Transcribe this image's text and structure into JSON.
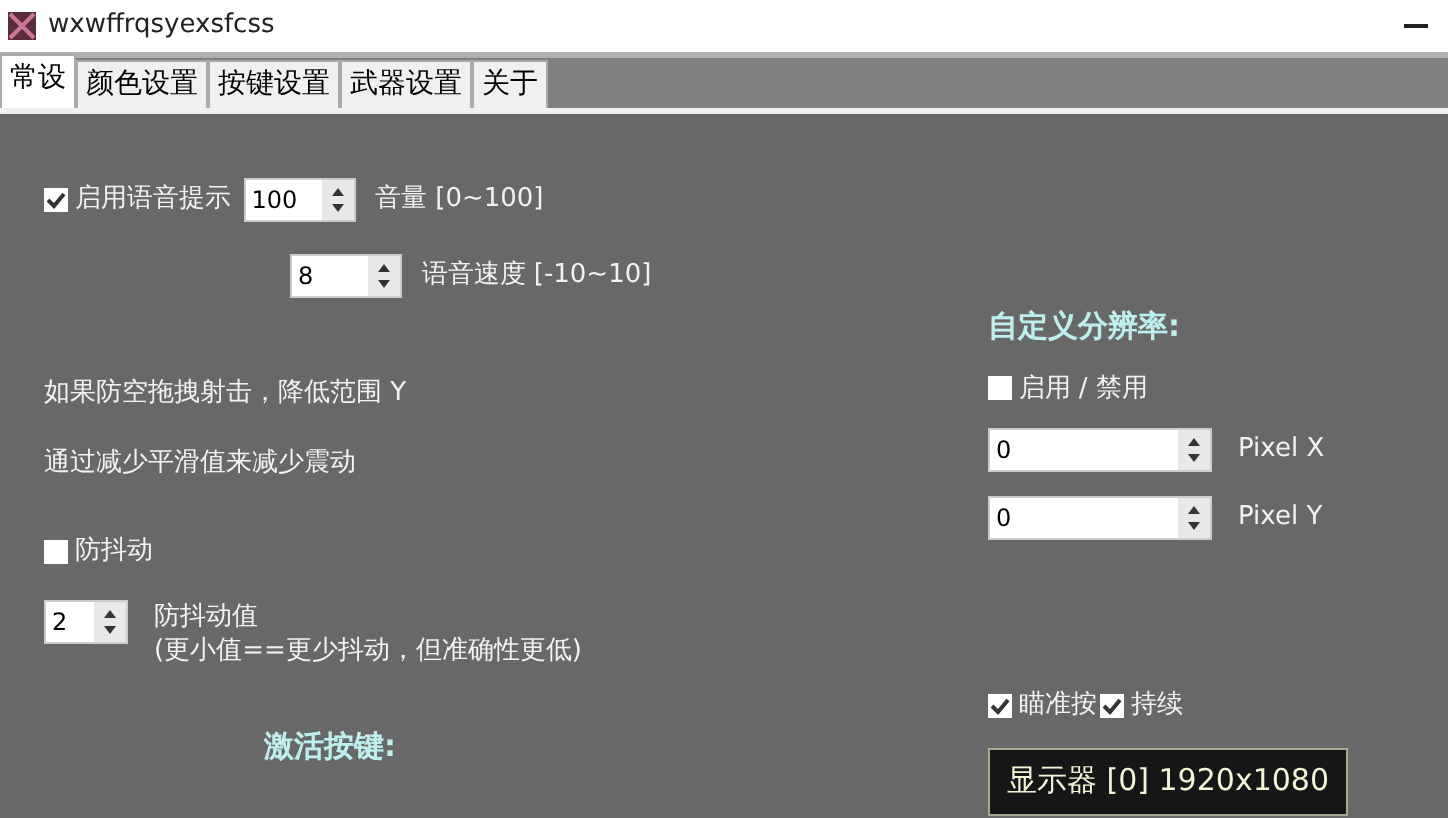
{
  "window": {
    "title": "wxwffrqsyexsfcss"
  },
  "tabs": [
    {
      "label": "常设",
      "selected": true
    },
    {
      "label": "颜色设置",
      "selected": false
    },
    {
      "label": "按键设置",
      "selected": false
    },
    {
      "label": "武器设置",
      "selected": false
    },
    {
      "label": "关于",
      "selected": false
    }
  ],
  "voice": {
    "checkbox": {
      "label": "启用语音提示",
      "checked": true
    },
    "volume": {
      "value": "100",
      "label": "音量 [0~100]"
    },
    "speed": {
      "value": "8",
      "label": "语音速度 [-10~10]"
    }
  },
  "notes": [
    "如果防空拖拽射击，降低范围 Y",
    "通过减少平滑值来减少震动"
  ],
  "anti_shake": {
    "checkbox": {
      "label": "防抖动",
      "checked": false
    },
    "value": "2",
    "label": "防抖动值",
    "hint": "(更小值==更少抖动，但准确性更低)"
  },
  "activation_heading": "激活按键:",
  "resolution": {
    "heading": "自定义分辨率:",
    "checkbox": {
      "label": "启用 / 禁用",
      "checked": false
    },
    "pixel_x": {
      "value": "0",
      "label": "Pixel X"
    },
    "pixel_y": {
      "value": "0",
      "label": "Pixel Y"
    }
  },
  "aim_options": [
    {
      "label": "瞄准按",
      "checked": true
    },
    {
      "label": "持续",
      "checked": true
    }
  ],
  "display_button": "显示器 [0] 1920x1080"
}
